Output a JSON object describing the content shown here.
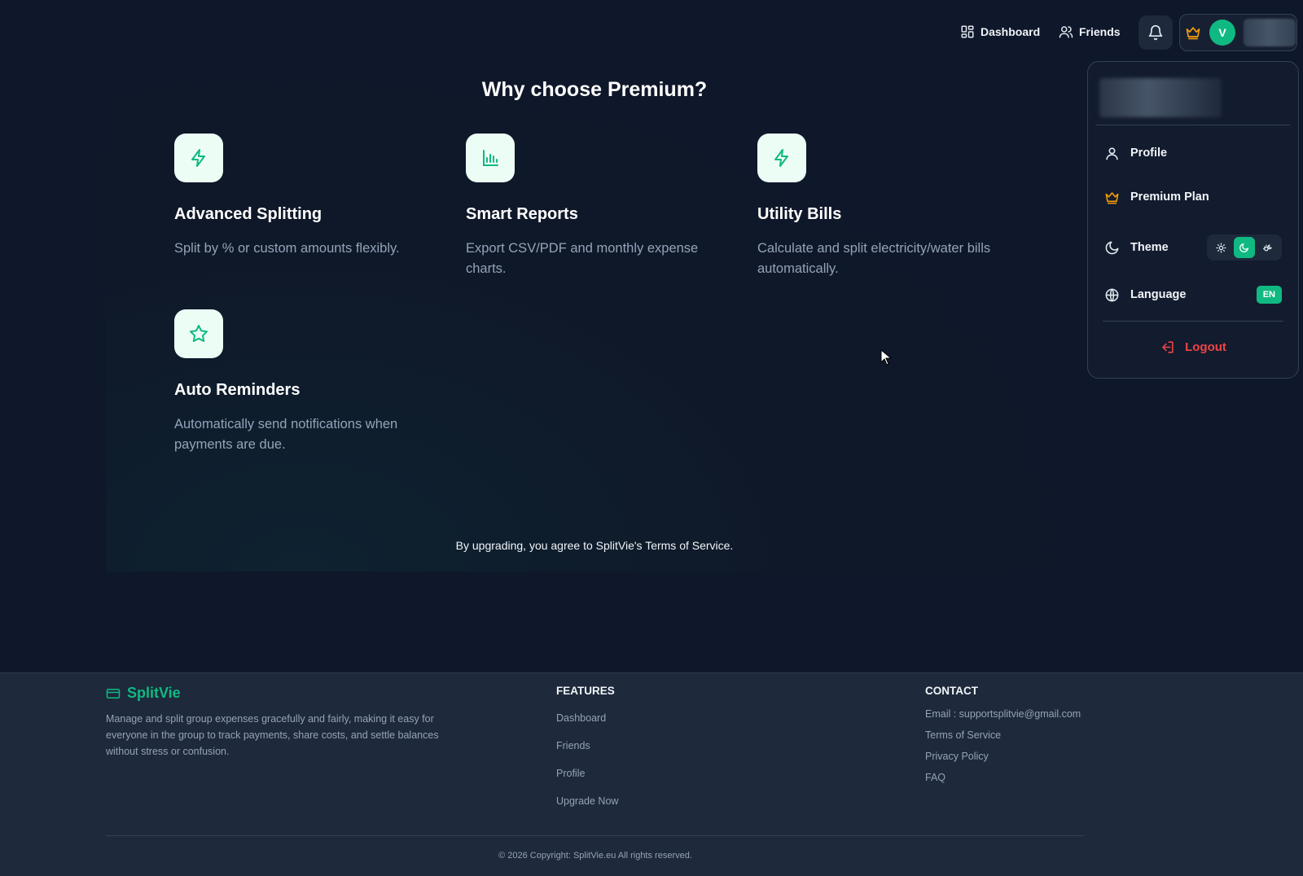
{
  "nav": {
    "dashboard_label": "Dashboard",
    "friends_label": "Friends",
    "avatar_initial": "V"
  },
  "premium": {
    "title": "Why choose Premium?",
    "features": [
      {
        "icon": "lightning-icon",
        "title": "Advanced Splitting",
        "description": "Split by % or custom amounts flexibly."
      },
      {
        "icon": "bar-chart-icon",
        "title": "Smart Reports",
        "description": "Export CSV/PDF and monthly expense charts."
      },
      {
        "icon": "lightning-icon",
        "title": "Utility Bills",
        "description": "Calculate and split electricity/water bills automatically."
      },
      {
        "icon": "star-icon",
        "title": "Auto Reminders",
        "description": "Automatically send notifications when payments are due."
      }
    ],
    "terms_note": "By upgrading, you agree to SplitVie's Terms of Service."
  },
  "user_menu": {
    "profile_label": "Profile",
    "premium_label": "Premium Plan",
    "theme_label": "Theme",
    "theme_options": [
      "light",
      "dark",
      "system"
    ],
    "theme_selected": "dark",
    "language_label": "Language",
    "language_value": "EN",
    "logout_label": "Logout"
  },
  "footer": {
    "brand": "SplitVie",
    "description": "Manage and split group expenses gracefully and fairly, making it easy for everyone in the group to track payments, share costs, and settle balances without stress or confusion.",
    "features_heading": "FEATURES",
    "features_links": [
      "Dashboard",
      "Friends",
      "Profile",
      "Upgrade Now"
    ],
    "contact_heading": "CONTACT",
    "contact_links": [
      "Email : supportsplitvie@gmail.com",
      "Terms of Service",
      "Privacy Policy",
      "FAQ"
    ],
    "copyright": "© 2026 Copyright: SplitVie.eu All rights reserved."
  },
  "colors": {
    "background": "#0f172a",
    "accent": "#10b981",
    "premium_gold": "#f59e0b",
    "danger": "#ef4444",
    "footer_bg": "#1e293b"
  }
}
